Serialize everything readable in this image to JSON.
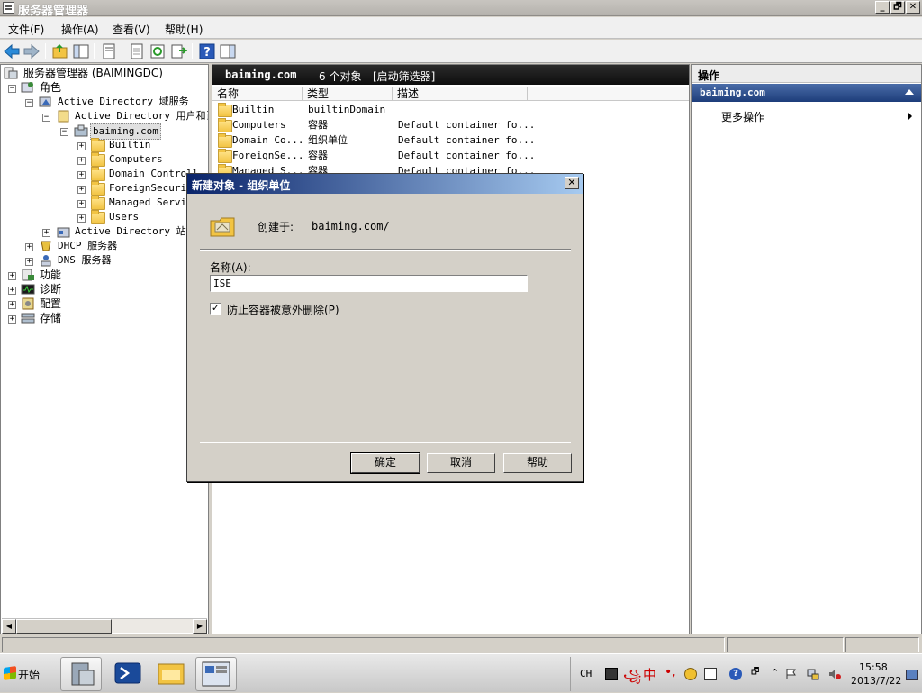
{
  "window": {
    "title": "服务器管理器",
    "buttons": [
      "_",
      "🗗",
      "✕"
    ]
  },
  "menubar": {
    "items": [
      "文件(F)",
      "操作(A)",
      "查看(V)",
      "帮助(H)"
    ]
  },
  "tree": {
    "root": "服务器管理器 (BAIMINGDC)",
    "roles": "角色",
    "ad_ds": "Active Directory 域服务",
    "ad_users": "Active Directory 用户和计",
    "domain": "baiming.com",
    "children": [
      "Builtin",
      "Computers",
      "Domain Controll",
      "ForeignSecurity",
      "Managed Servic",
      "Users"
    ],
    "ad_sites": "Active Directory 站点",
    "dhcp": "DHCP 服务器",
    "dns": "DNS 服务器",
    "features": "功能",
    "diagnostics": "诊断",
    "configuration": "配置",
    "storage": "存储"
  },
  "center": {
    "header_domain": "baiming.com",
    "header_count": "6 个对象",
    "header_filter": "[启动筛选器]",
    "columns": [
      "名称",
      "类型",
      "描述"
    ],
    "rows": [
      {
        "name": "Builtin",
        "type": "builtinDomain",
        "desc": ""
      },
      {
        "name": "Computers",
        "type": "容器",
        "desc": "Default container fo..."
      },
      {
        "name": "Domain Co...",
        "type": "组织单位",
        "desc": "Default container fo..."
      },
      {
        "name": "ForeignSe...",
        "type": "容器",
        "desc": "Default container fo..."
      },
      {
        "name": "Managed S...",
        "type": "容器",
        "desc": "Default container fo..."
      }
    ]
  },
  "actions": {
    "title": "操作",
    "section": "baiming.com",
    "more": "更多操作"
  },
  "dialog": {
    "title": "新建对象 - 组织单位",
    "created_in_label": "创建于:",
    "created_in_value": "baiming.com/",
    "name_label": "名称(A):",
    "name_value": "ISE",
    "protect_label": "防止容器被意外删除(P)",
    "protect_checked": true,
    "ok": "确定",
    "cancel": "取消",
    "help": "帮助"
  },
  "taskbar": {
    "start": "开始",
    "lang": "CH",
    "ime": "中",
    "time": "15:58",
    "date": "2013/7/22"
  },
  "colors": {
    "accent": "#0a246a",
    "header_dark": "#111111",
    "actions_blue": "#1d3d7a"
  }
}
